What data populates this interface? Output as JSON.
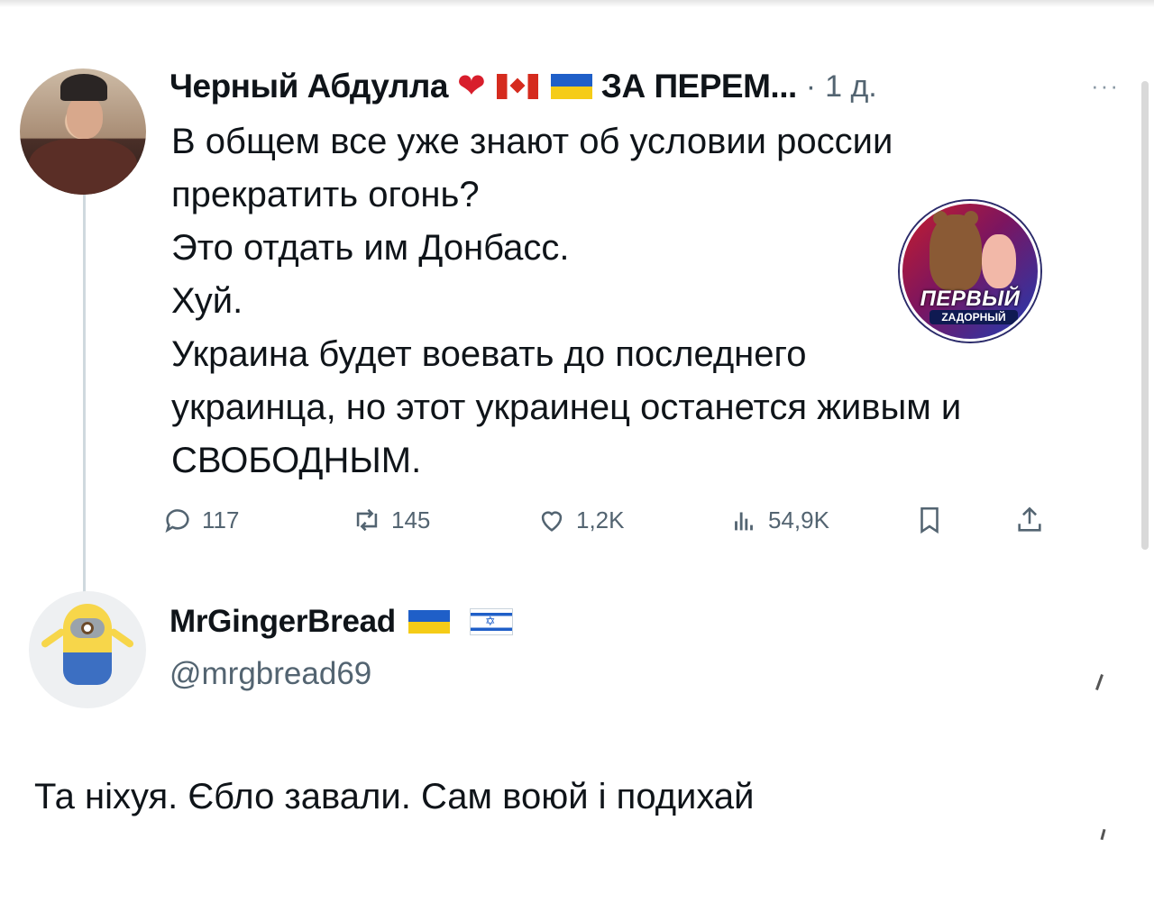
{
  "tweet": {
    "author_name": "Черный Абдулла",
    "heart_emoji": "❤️",
    "author_tag": "ЗА ПЕРЕМ...",
    "separator": "·",
    "time": "1 д.",
    "more": "···",
    "lines": [
      "В общем все уже знают об условии россии",
      "прекратить огонь?",
      "Это отдать им Донбасс.",
      "Хуй.",
      "Украина будет воевать до последнего",
      "украинца, но этот украинец останется живым и",
      "СВОБОДНЫМ."
    ],
    "stats": {
      "replies": "117",
      "retweets": "145",
      "likes": "1,2K",
      "views": "54,9K"
    }
  },
  "watermark": {
    "line1": "ПЕРВЫЙ",
    "line2": "ZАДОРНЫЙ"
  },
  "reply": {
    "author_name": "MrGingerBread",
    "handle": "@mrgbread69",
    "text": "Та ніхуя. Єбло завали. Сам воюй і подихай"
  },
  "icons": [
    "reply-icon",
    "retweet-icon",
    "like-icon",
    "views-icon",
    "bookmark-icon",
    "share-icon"
  ],
  "colors": {
    "text": "#0f1419",
    "muted": "#536471",
    "thread_line": "#cfd9de",
    "heart": "#d81e2c"
  }
}
